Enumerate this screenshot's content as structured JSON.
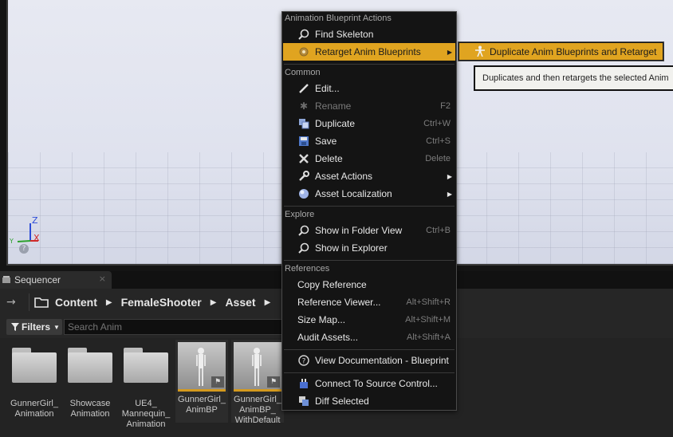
{
  "viewport": {
    "axis": {
      "z": "Z",
      "x": "X",
      "y": "Y"
    },
    "help_glyph": "?"
  },
  "tab": {
    "label": "Sequencer",
    "close_glyph": "×"
  },
  "path": {
    "nav_glyph": "→",
    "crumbs": [
      "Content",
      "FemaleShooter",
      "Asset"
    ],
    "arrow_glyph": "▶"
  },
  "filters": {
    "label": "Filters",
    "search_placeholder": "Search Anim"
  },
  "assets": {
    "folders": [
      {
        "label": "GunnerGirl_\nAnimation"
      },
      {
        "label": "Showcase\nAnimation"
      },
      {
        "label": "UE4_\nMannequin_\nAnimation"
      }
    ],
    "blueprints": [
      {
        "label": "GunnerGirl_\nAnimBP"
      },
      {
        "label": "GunnerGirl_\nAnimBP_\nWithDefault"
      }
    ]
  },
  "menu": {
    "sections": {
      "anim_bp_actions": "Animation Blueprint Actions",
      "common": "Common",
      "explore": "Explore",
      "references": "References"
    },
    "items": {
      "find_skeleton": {
        "label": "Find Skeleton"
      },
      "retarget": {
        "label": "Retarget Anim Blueprints"
      },
      "edit": {
        "label": "Edit..."
      },
      "rename": {
        "label": "Rename",
        "shortcut": "F2"
      },
      "duplicate": {
        "label": "Duplicate",
        "shortcut": "Ctrl+W"
      },
      "save": {
        "label": "Save",
        "shortcut": "Ctrl+S"
      },
      "delete": {
        "label": "Delete",
        "shortcut": "Delete"
      },
      "asset_actions": {
        "label": "Asset Actions"
      },
      "asset_localization": {
        "label": "Asset Localization"
      },
      "show_folder": {
        "label": "Show in Folder View",
        "shortcut": "Ctrl+B"
      },
      "show_explorer": {
        "label": "Show in Explorer"
      },
      "copy_reference": {
        "label": "Copy Reference"
      },
      "reference_viewer": {
        "label": "Reference Viewer...",
        "shortcut": "Alt+Shift+R"
      },
      "size_map": {
        "label": "Size Map...",
        "shortcut": "Alt+Shift+M"
      },
      "audit_assets": {
        "label": "Audit Assets...",
        "shortcut": "Alt+Shift+A"
      },
      "view_docs": {
        "label": "View Documentation - Blueprint"
      },
      "connect_source": {
        "label": "Connect To Source Control..."
      },
      "diff_selected": {
        "label": "Diff Selected"
      }
    },
    "submenu_arrow": "▶"
  },
  "submenu": {
    "label": "Duplicate Anim Blueprints and Retarget"
  },
  "tooltip": {
    "text": "Duplicates and then retargets the selected Anim"
  },
  "colors": {
    "highlight": "#e0a420",
    "menu_bg": "#141414",
    "tooltip_bg": "#f1f1ee"
  }
}
